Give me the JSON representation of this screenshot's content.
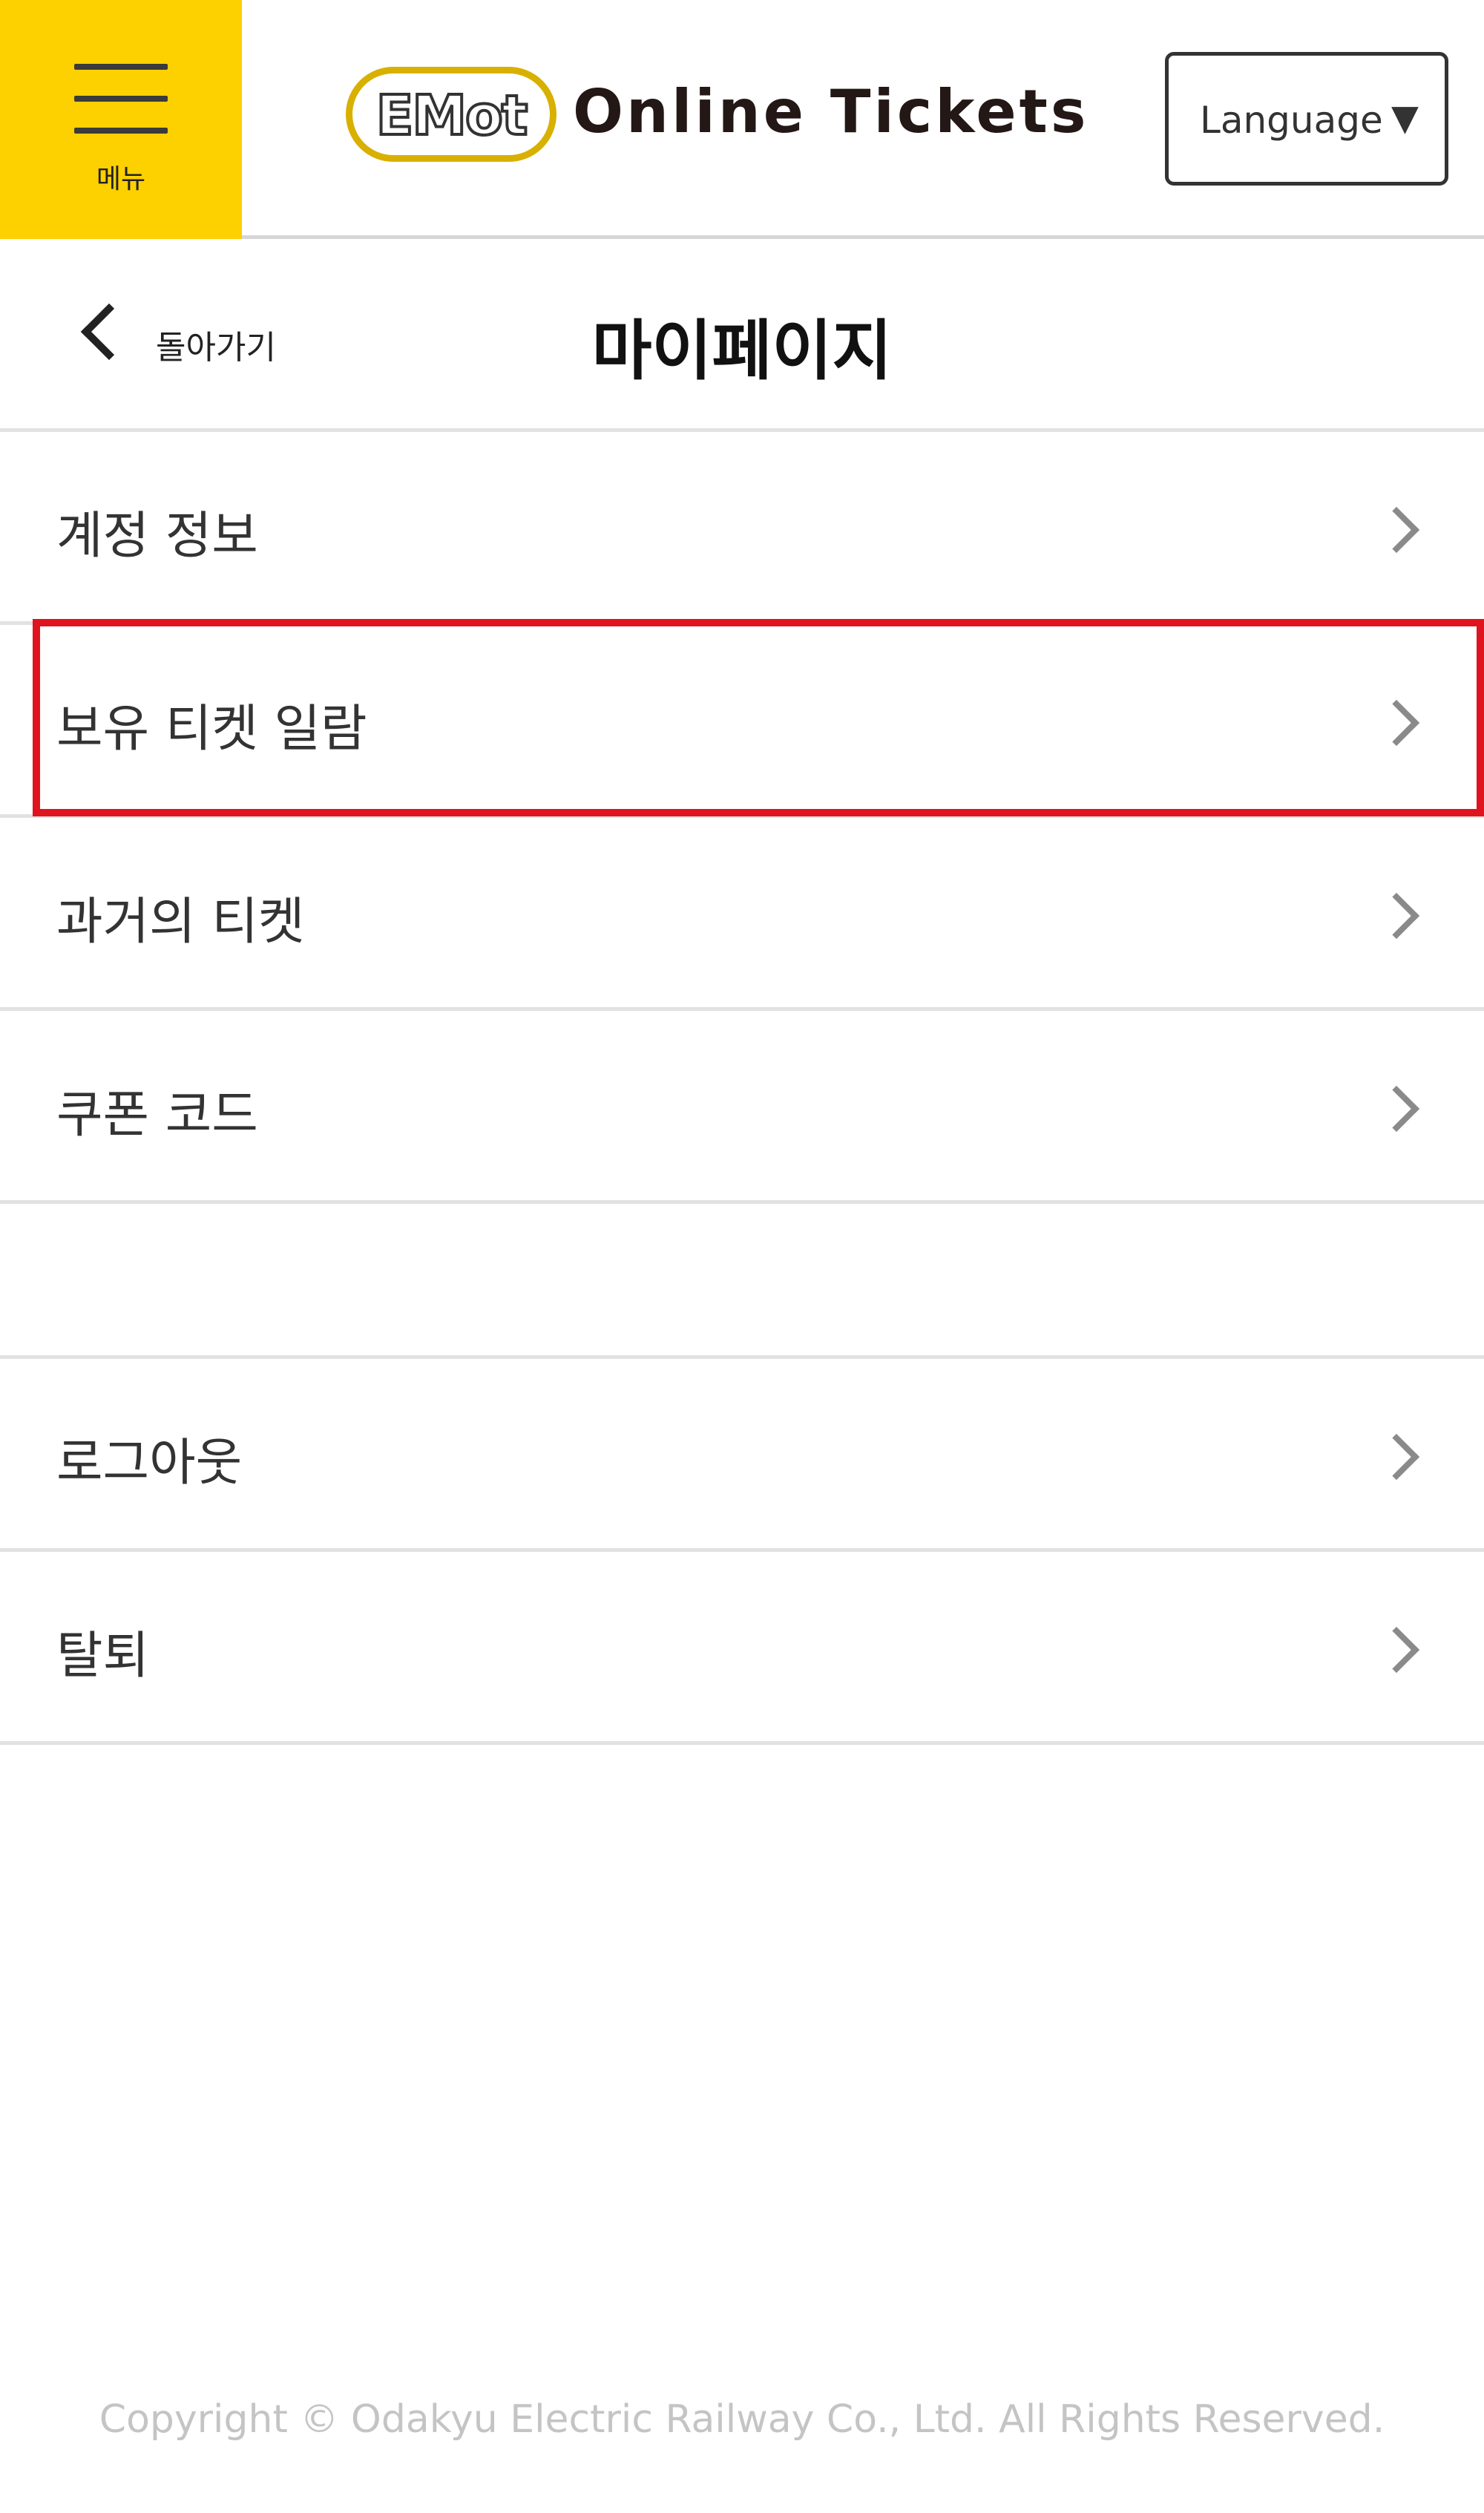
{
  "header": {
    "menu_label": "메뉴",
    "logo_badge": "EMot",
    "logo_text": "Online Tickets",
    "language_label": "Language",
    "language_caret": "▼"
  },
  "subheader": {
    "back_label": "돌아가기",
    "title": "마이페이지"
  },
  "menu_items": [
    {
      "label": "계정 정보"
    },
    {
      "label": "보유 티켓 일람"
    },
    {
      "label": "과거의 티켓"
    },
    {
      "label": "쿠폰 코드"
    },
    {
      "label": "로그아웃"
    },
    {
      "label": "탈퇴"
    }
  ],
  "footer": {
    "copyright": "Copyright © Odakyu Electric Railway Co., Ltd. All Rights Reserved."
  },
  "colors": {
    "brand_yellow": "#fdd000",
    "highlight_red": "#e0141e"
  }
}
